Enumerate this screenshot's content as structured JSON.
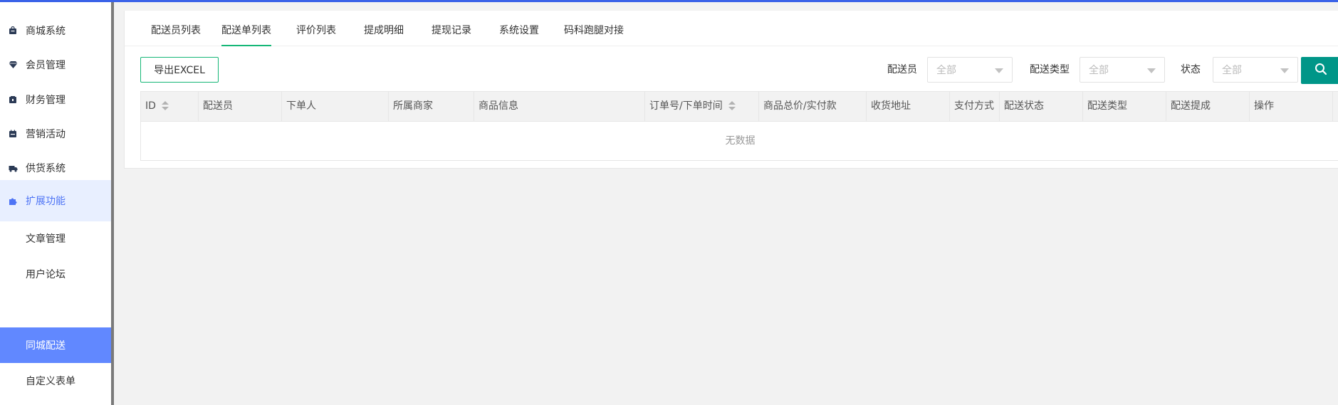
{
  "sidebar": {
    "items": [
      {
        "label": "商城系统",
        "icon": "shopping-bag-icon"
      },
      {
        "label": "会员管理",
        "icon": "diamond-icon"
      },
      {
        "label": "财务管理",
        "icon": "wallet-icon"
      },
      {
        "label": "营销活动",
        "icon": "calendar-icon"
      },
      {
        "label": "供货系统",
        "icon": "truck-icon"
      },
      {
        "label": "扩展功能",
        "icon": "puzzle-icon"
      }
    ],
    "subitems": [
      {
        "label": "文章管理"
      },
      {
        "label": "用户论坛"
      },
      {
        "label": "同城配送"
      },
      {
        "label": "自定义表单"
      }
    ]
  },
  "tabs": [
    {
      "label": "配送员列表"
    },
    {
      "label": "配送单列表"
    },
    {
      "label": "评价列表"
    },
    {
      "label": "提成明细"
    },
    {
      "label": "提现记录"
    },
    {
      "label": "系统设置"
    },
    {
      "label": "码科跑腿对接"
    }
  ],
  "toolbar": {
    "export_label": "导出EXCEL",
    "filters": {
      "courier_label": "配送员",
      "courier_value": "全部",
      "type_label": "配送类型",
      "type_value": "全部",
      "status_label": "状态",
      "status_value": "全部"
    }
  },
  "table": {
    "columns": [
      "ID",
      "配送员",
      "下单人",
      "所属商家",
      "商品信息",
      "订单号/下单时间",
      "商品总价/实付款",
      "收货地址",
      "支付方式",
      "配送状态",
      "配送类型",
      "配送提成",
      "操作"
    ],
    "empty_text": "无数据"
  },
  "colors": {
    "accent_green": "#16b777",
    "search_button": "#009688",
    "sidebar_selected": "#6188ff",
    "sidebar_active_text": "#4e74f5",
    "top_bar": "#3a62e8"
  }
}
